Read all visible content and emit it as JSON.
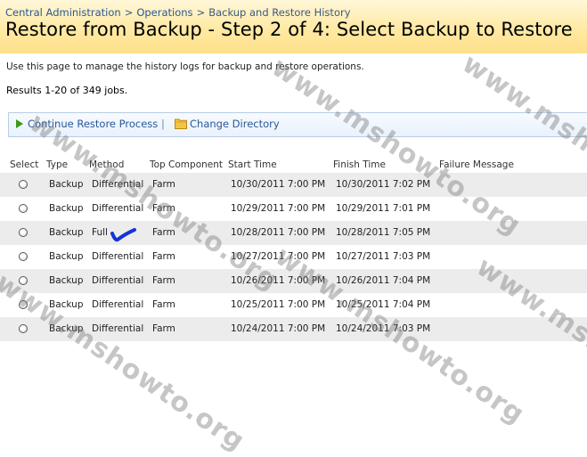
{
  "breadcrumb": {
    "items": [
      "Central Administration",
      "Operations",
      "Backup and Restore History"
    ],
    "separator": ">"
  },
  "page_title": "Restore from Backup - Step 2 of 4: Select Backup to Restore",
  "description": "Use this page to manage the history logs for backup and restore operations.",
  "results_text": "Results 1-20 of 349 jobs.",
  "toolbar": {
    "continue_label": "Continue Restore Process",
    "separator": "|",
    "change_dir_label": "Change Directory"
  },
  "table": {
    "columns": [
      "Select",
      "Type",
      "Method",
      "Top Component",
      "Start Time",
      "Finish Time",
      "Failure Message"
    ],
    "rows": [
      {
        "type": "Backup",
        "method": "Differential",
        "component": "Farm",
        "start": "10/30/2011 7:00 PM",
        "finish": "10/30/2011 7:02 PM",
        "failure": ""
      },
      {
        "type": "Backup",
        "method": "Differential",
        "component": "Farm",
        "start": "10/29/2011 7:00 PM",
        "finish": "10/29/2011 7:01 PM",
        "failure": ""
      },
      {
        "type": "Backup",
        "method": "Full",
        "component": "Farm",
        "start": "10/28/2011 7:00 PM",
        "finish": "10/28/2011 7:05 PM",
        "failure": ""
      },
      {
        "type": "Backup",
        "method": "Differential",
        "component": "Farm",
        "start": "10/27/2011 7:00 PM",
        "finish": "10/27/2011 7:03 PM",
        "failure": ""
      },
      {
        "type": "Backup",
        "method": "Differential",
        "component": "Farm",
        "start": "10/26/2011 7:00 PM",
        "finish": "10/26/2011 7:04 PM",
        "failure": ""
      },
      {
        "type": "Backup",
        "method": "Differential",
        "component": "Farm",
        "start": "10/25/2011 7:00 PM",
        "finish": "10/25/2011 7:04 PM",
        "failure": ""
      },
      {
        "type": "Backup",
        "method": "Differential",
        "component": "Farm",
        "start": "10/24/2011 7:00 PM",
        "finish": "10/24/2011 7:03 PM",
        "failure": ""
      }
    ]
  },
  "watermark": "www.mshowto.org",
  "icons": {
    "continue": "play-arrow-icon",
    "change_dir": "folder-icon",
    "annotation": "hand-drawn-checkmark-icon"
  },
  "colors": {
    "header_bg": "#ffe9a3",
    "link": "#2b5797",
    "toolbar_border": "#b9cde5",
    "play_icon": "#3a9a1a",
    "annotation": "#1533d8",
    "row_alt": "#ececec"
  }
}
